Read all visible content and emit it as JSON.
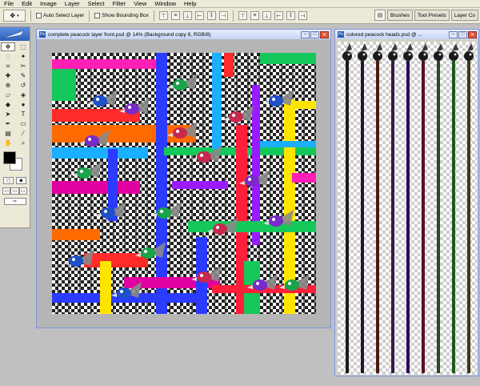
{
  "menubar": {
    "items": [
      "File",
      "Edit",
      "Image",
      "Layer",
      "Select",
      "Filter",
      "View",
      "Window",
      "Help"
    ]
  },
  "options_bar": {
    "auto_select_label": "Auto Select Layer",
    "show_bounding_box_label": "Show Bounding Box"
  },
  "palette_well": {
    "tabs": [
      "Brushes",
      "Tool Presets",
      "Layer Co"
    ]
  },
  "documents": [
    {
      "title": "complete peacock layer front.psd @ 14% (Background copy 8, RGB/8)"
    },
    {
      "title": "colored peacock heads.psd @ ..."
    }
  ],
  "toolbox": {
    "tools": [
      "move",
      "marquee",
      "lasso",
      "magic-wand",
      "crop",
      "slice",
      "healing-brush",
      "brush",
      "clone-stamp",
      "history-brush",
      "eraser",
      "paint-bucket",
      "blur",
      "dodge",
      "path-selection",
      "type",
      "pen",
      "rectangle",
      "notes",
      "eyedropper",
      "hand",
      "zoom"
    ],
    "foreground_color": "#000000",
    "background_color": "#ffffff"
  },
  "stick_colors": [
    "#1a1a1a",
    "#2a1030",
    "#4a1a10",
    "#3a1a4a",
    "#2a0a5a",
    "#5a1020",
    "#2a4a1a",
    "#1a5a1a",
    "#3a3a10",
    "#0a6a1a"
  ]
}
